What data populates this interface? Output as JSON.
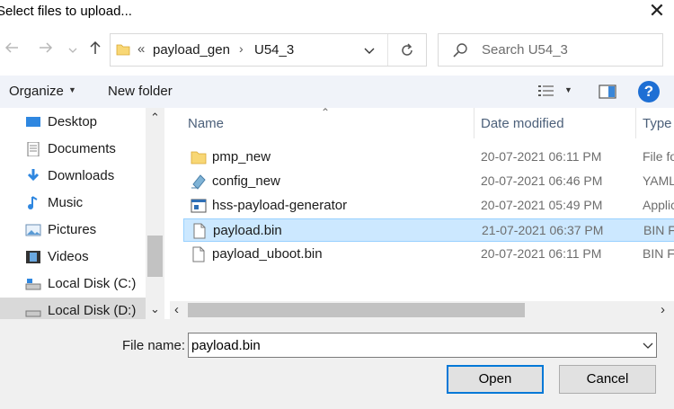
{
  "window": {
    "title": "Select files to upload..."
  },
  "nav": {
    "breadcrumb_overflow": "«",
    "breadcrumbs": [
      "payload_gen",
      "U54_3"
    ],
    "breadcrumb_separator": "›"
  },
  "search": {
    "placeholder": "Search U54_3"
  },
  "toolbar": {
    "organize_label": "Organize",
    "new_folder_label": "New folder"
  },
  "sidebar": {
    "items": [
      {
        "label": "Desktop",
        "icon": "desktop-icon"
      },
      {
        "label": "Documents",
        "icon": "documents-icon"
      },
      {
        "label": "Downloads",
        "icon": "downloads-icon"
      },
      {
        "label": "Music",
        "icon": "music-icon"
      },
      {
        "label": "Pictures",
        "icon": "pictures-icon"
      },
      {
        "label": "Videos",
        "icon": "videos-icon"
      },
      {
        "label": "Local Disk (C:)",
        "icon": "drive-icon"
      },
      {
        "label": "Local Disk (D:)",
        "icon": "drive-icon",
        "selected": true
      }
    ]
  },
  "file_list": {
    "columns": {
      "name": "Name",
      "date": "Date modified",
      "type": "Type"
    },
    "rows": [
      {
        "name": "pmp_new",
        "date": "20-07-2021 06:11 PM",
        "type": "File fo",
        "icon": "folder-icon"
      },
      {
        "name": "config_new",
        "date": "20-07-2021 06:46 PM",
        "type": "YAML",
        "icon": "yaml-file-icon"
      },
      {
        "name": "hss-payload-generator",
        "date": "20-07-2021 05:49 PM",
        "type": "Applic",
        "icon": "application-icon"
      },
      {
        "name": "payload.bin",
        "date": "21-07-2021 06:37 PM",
        "type": "BIN Fi",
        "icon": "file-icon",
        "selected": true
      },
      {
        "name": "payload_uboot.bin",
        "date": "20-07-2021 06:11 PM",
        "type": "BIN Fi",
        "icon": "file-icon"
      }
    ]
  },
  "bottom": {
    "file_name_label": "File name:",
    "file_name_value": "payload.bin",
    "open_label": "Open",
    "cancel_label": "Cancel"
  },
  "colors": {
    "selection": "#cce8ff",
    "accent": "#0078d7",
    "toolbar_bg": "#f0f3f9"
  }
}
